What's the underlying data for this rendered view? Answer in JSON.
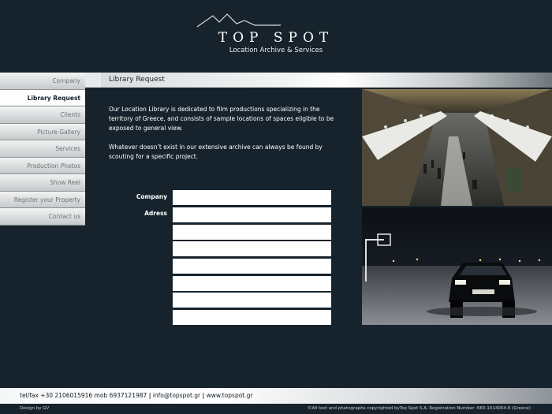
{
  "header": {
    "brand": "TOP SPOT",
    "tagline": "Location Archive & Services"
  },
  "menu": {
    "items": [
      {
        "label": "Company",
        "active": false
      },
      {
        "label": "Library Request",
        "active": true
      },
      {
        "label": "Clients",
        "active": false
      },
      {
        "label": "Picture Gallery",
        "active": false
      },
      {
        "label": "Services",
        "active": false
      },
      {
        "label": "Production Photos",
        "active": false
      },
      {
        "label": "Show Reel",
        "active": false
      },
      {
        "label": "Register your Property",
        "active": false
      },
      {
        "label": "Contact us",
        "active": false
      }
    ]
  },
  "page": {
    "title": "Library Request",
    "intro_1": "Our Location Library is dedicated to film productions specializing in the territory of Greece, and consists of sample locations of spaces eligible to be exposed to general view.",
    "intro_2": "Whatever doesn’t exist in our extensive archive can always be found by scouting for a specific project."
  },
  "form": {
    "company_label": "Company",
    "address_label": "Adress",
    "fields": [
      "",
      "",
      "",
      "",
      "",
      "",
      "",
      ""
    ]
  },
  "footer": {
    "phone": "tel/fax +30 2106015916 mob 6937121987",
    "email": "info@topspot.gr",
    "web": "www.topspot.gr",
    "separator": "|",
    "design": "Design by GV",
    "copyright": "©All text and photographs copyrighted byTop Spot S.A. Registration Number: 660-1014004-6 (Greece)"
  },
  "colors": {
    "background": "#16232c",
    "menu_active": "#fdfdfd",
    "menu_inactive_text": "#6d7478"
  }
}
